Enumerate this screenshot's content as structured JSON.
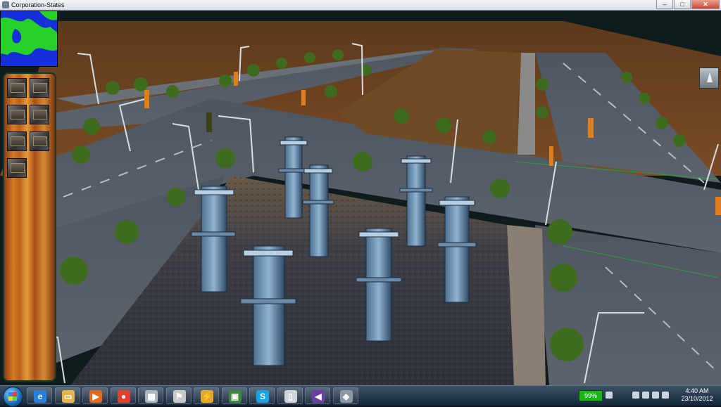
{
  "window": {
    "title": "Corporation-States",
    "controls": {
      "minimize": "–",
      "maximize": "□",
      "close": "✕"
    }
  },
  "game": {
    "sidebar_tools": [
      "tool-1",
      "tool-2",
      "tool-3",
      "tool-4",
      "tool-5",
      "tool-6",
      "tool-7"
    ]
  },
  "tray": {
    "battery": "99%",
    "time": "4:40 AM",
    "date": "23/10/2012"
  },
  "taskbar_apps": [
    {
      "name": "internet-explorer",
      "glyph": "e",
      "color": "#2a7fd4"
    },
    {
      "name": "file-explorer",
      "glyph": "▭",
      "color": "#e3b44a"
    },
    {
      "name": "media-player",
      "glyph": "▶",
      "color": "#e26a1c"
    },
    {
      "name": "chrome",
      "glyph": "●",
      "color": "#e0412f"
    },
    {
      "name": "task-manager",
      "glyph": "▦",
      "color": "#aeb7c0"
    },
    {
      "name": "counter-strike",
      "glyph": "⚑",
      "color": "#c9c9c9"
    },
    {
      "name": "winamp",
      "glyph": "⚡",
      "color": "#e7a531"
    },
    {
      "name": "game-launcher",
      "glyph": "▣",
      "color": "#3b8a3b"
    },
    {
      "name": "skype",
      "glyph": "S",
      "color": "#19a3e0"
    },
    {
      "name": "folder",
      "glyph": "▯",
      "color": "#cfd4da"
    },
    {
      "name": "visual-studio",
      "glyph": "◀",
      "color": "#6b3fa0"
    },
    {
      "name": "corporation-states",
      "glyph": "◈",
      "color": "#8c98a4"
    }
  ]
}
